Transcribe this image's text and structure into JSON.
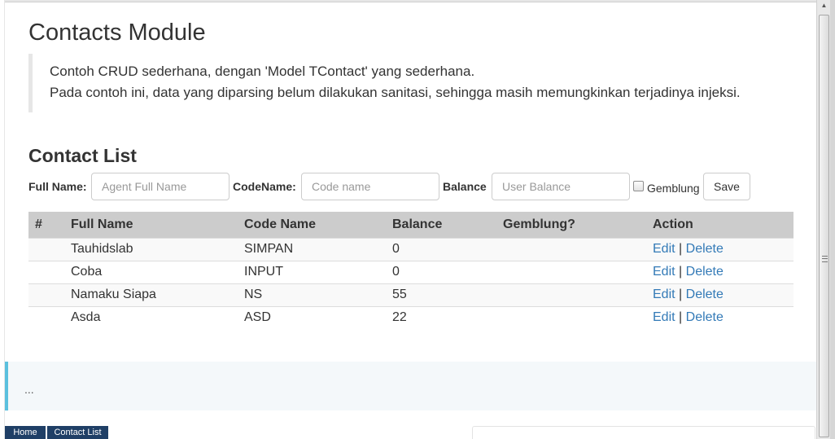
{
  "page": {
    "title": "Contacts Module",
    "description_line1": "Contoh CRUD sederhana, dengan 'Model TContact' yang sederhana.",
    "description_line2": "Pada contoh ini, data yang diparsing belum dilakukan sanitasi, sehingga masih memungkinkan terjadinya injeksi."
  },
  "contact_list": {
    "heading": "Contact List",
    "form": {
      "full_name_label": "Full Name:",
      "full_name_placeholder": "Agent Full Name",
      "full_name_value": "",
      "codename_label": "CodeName:",
      "codename_placeholder": "Code name",
      "codename_value": "",
      "balance_label": "Balance",
      "balance_placeholder": "User Balance",
      "balance_value": "",
      "gemblung_label": "Gemblung",
      "gemblung_checked": false,
      "save_label": "Save"
    },
    "table": {
      "headers": [
        "#",
        "Full Name",
        "Code Name",
        "Balance",
        "Gemblung?",
        "Action"
      ],
      "rows": [
        {
          "num": "",
          "full_name": "Tauhidslab",
          "code_name": "SIMPAN",
          "balance": "0",
          "gemblung": "",
          "edit": "Edit",
          "sep": "|",
          "delete": "Delete"
        },
        {
          "num": "",
          "full_name": "Coba",
          "code_name": "INPUT",
          "balance": "0",
          "gemblung": "",
          "edit": "Edit",
          "sep": "|",
          "delete": "Delete"
        },
        {
          "num": "",
          "full_name": "Namaku Siapa",
          "code_name": "NS",
          "balance": "55",
          "gemblung": "",
          "edit": "Edit",
          "sep": "|",
          "delete": "Delete"
        },
        {
          "num": "",
          "full_name": "Asda",
          "code_name": "ASD",
          "balance": "22",
          "gemblung": "",
          "edit": "Edit",
          "sep": "|",
          "delete": "Delete"
        }
      ]
    }
  },
  "footer_note": {
    "text": "..."
  },
  "breadcrumbs": [
    "Home",
    "Contact List"
  ],
  "colors": {
    "link": "#337ab7",
    "header_bg": "#cccccc",
    "crumb_bg": "#1f3f66",
    "note_accent": "#5bc0de"
  }
}
